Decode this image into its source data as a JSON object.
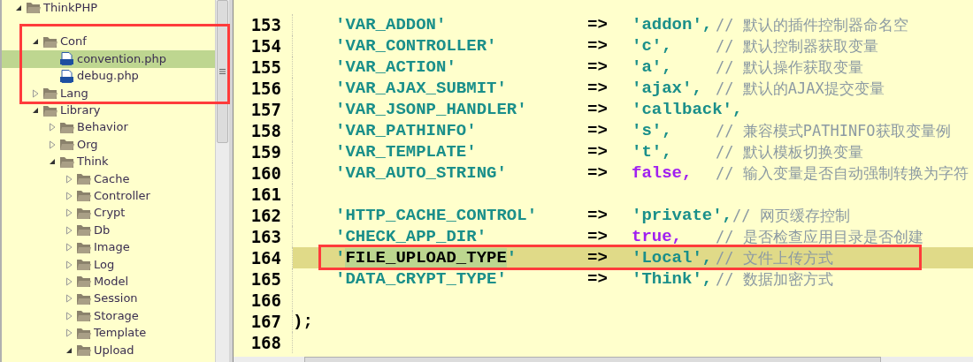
{
  "tree": [
    {
      "label": "ThinkPHP",
      "kind": "folder",
      "expanded": true,
      "selected": false,
      "children": [
        {
          "label": "Conf",
          "kind": "folder",
          "expanded": true,
          "selected": false,
          "children": [
            {
              "label": "convention.php",
              "kind": "file",
              "selected": true
            },
            {
              "label": "debug.php",
              "kind": "file",
              "selected": false
            }
          ]
        },
        {
          "label": "Lang",
          "kind": "folder",
          "expanded": false,
          "selected": false
        },
        {
          "label": "Library",
          "kind": "folder",
          "expanded": true,
          "selected": false,
          "children": [
            {
              "label": "Behavior",
              "kind": "folder",
              "expanded": false,
              "selected": false
            },
            {
              "label": "Org",
              "kind": "folder",
              "expanded": false,
              "selected": false
            },
            {
              "label": "Think",
              "kind": "folder",
              "expanded": true,
              "selected": false,
              "children": [
                {
                  "label": "Cache",
                  "kind": "folder",
                  "expanded": false,
                  "selected": false
                },
                {
                  "label": "Controller",
                  "kind": "folder",
                  "expanded": false,
                  "selected": false
                },
                {
                  "label": "Crypt",
                  "kind": "folder",
                  "expanded": false,
                  "selected": false
                },
                {
                  "label": "Db",
                  "kind": "folder",
                  "expanded": false,
                  "selected": false
                },
                {
                  "label": "Image",
                  "kind": "folder",
                  "expanded": false,
                  "selected": false
                },
                {
                  "label": "Log",
                  "kind": "folder",
                  "expanded": false,
                  "selected": false
                },
                {
                  "label": "Model",
                  "kind": "folder",
                  "expanded": false,
                  "selected": false
                },
                {
                  "label": "Session",
                  "kind": "folder",
                  "expanded": false,
                  "selected": false
                },
                {
                  "label": "Storage",
                  "kind": "folder",
                  "expanded": false,
                  "selected": false
                },
                {
                  "label": "Template",
                  "kind": "folder",
                  "expanded": false,
                  "selected": false
                },
                {
                  "label": "Upload",
                  "kind": "folder",
                  "expanded": true,
                  "selected": false
                }
              ]
            }
          ]
        }
      ]
    }
  ],
  "code_lines": [
    {
      "number": "153",
      "kind": "entry",
      "current": false,
      "key_selected": false,
      "key": "'VAR_ADDON'",
      "arrow": "=>",
      "value": "'addon',",
      "value_is_keyword": false,
      "comment": "// 默认的插件控制器命名空"
    },
    {
      "number": "154",
      "kind": "entry",
      "current": false,
      "key_selected": false,
      "key": "'VAR_CONTROLLER'",
      "arrow": "=>",
      "value": "'c',",
      "value_is_keyword": false,
      "comment": "// 默认控制器获取变量"
    },
    {
      "number": "155",
      "kind": "entry",
      "current": false,
      "key_selected": false,
      "key": "'VAR_ACTION'",
      "arrow": "=>",
      "value": "'a',",
      "value_is_keyword": false,
      "comment": "// 默认操作获取变量"
    },
    {
      "number": "156",
      "kind": "entry",
      "current": false,
      "key_selected": false,
      "key": "'VAR_AJAX_SUBMIT'",
      "arrow": "=>",
      "value": "'ajax',",
      "value_is_keyword": false,
      "comment": "// 默认的AJAX提交变量"
    },
    {
      "number": "157",
      "kind": "entry",
      "current": false,
      "key_selected": false,
      "key": "'VAR_JSONP_HANDLER'",
      "arrow": "=>",
      "value": "'callback',",
      "value_is_keyword": false
    },
    {
      "number": "158",
      "kind": "entry",
      "current": false,
      "key_selected": false,
      "key": "'VAR_PATHINFO'",
      "arrow": "=>",
      "value": "'s',",
      "value_is_keyword": false,
      "comment": "// 兼容模式PATHINFO获取变量例"
    },
    {
      "number": "159",
      "kind": "entry",
      "current": false,
      "key_selected": false,
      "key": "'VAR_TEMPLATE'",
      "arrow": "=>",
      "value": "'t',",
      "value_is_keyword": false,
      "comment": "// 默认模板切换变量"
    },
    {
      "number": "160",
      "kind": "entry",
      "current": false,
      "key_selected": false,
      "key": "'VAR_AUTO_STRING'",
      "arrow": "=>",
      "value": "false,",
      "value_is_keyword": true,
      "comment": "// 输入变量是否自动强制转换为字符"
    },
    {
      "number": "161",
      "kind": "blank",
      "current": false
    },
    {
      "number": "162",
      "kind": "entry",
      "current": false,
      "key_selected": false,
      "key": "'HTTP_CACHE_CONTROL'",
      "arrow": "=>",
      "value": "'private',",
      "value_is_keyword": false,
      "comment": "// 网页缓存控制"
    },
    {
      "number": "163",
      "kind": "entry",
      "current": false,
      "key_selected": false,
      "key": "'CHECK_APP_DIR'",
      "arrow": "=>",
      "value": "true,",
      "value_is_keyword": true,
      "comment": "// 是否检查应用目录是否创建"
    },
    {
      "number": "164",
      "kind": "entry",
      "current": true,
      "key_selected": true,
      "key": "'FILE_UPLOAD_TYPE'",
      "arrow": "=>",
      "value": "'Local',",
      "value_is_keyword": false,
      "comment": "// 文件上传方式"
    },
    {
      "number": "165",
      "kind": "entry",
      "current": false,
      "key_selected": false,
      "key": "'DATA_CRYPT_TYPE'",
      "arrow": "=>",
      "value": "'Think',",
      "value_is_keyword": false,
      "comment": "// 数据加密方式"
    },
    {
      "number": "166",
      "kind": "blank",
      "current": false
    },
    {
      "number": "167",
      "kind": "close",
      "current": false,
      "text": ");"
    },
    {
      "number": "168",
      "kind": "blank",
      "current": false
    }
  ]
}
